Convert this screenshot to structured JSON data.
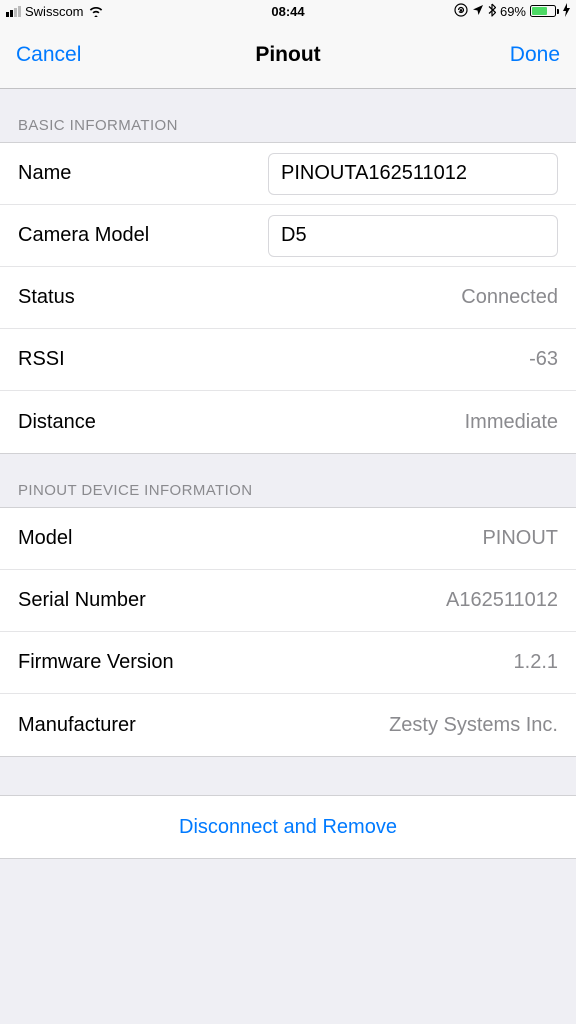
{
  "statusBar": {
    "carrier": "Swisscom",
    "time": "08:44",
    "battery": "69%",
    "batteryPct": 69
  },
  "nav": {
    "cancel": "Cancel",
    "title": "Pinout",
    "done": "Done"
  },
  "sections": {
    "basic": {
      "header": "BASIC INFORMATION",
      "nameLabel": "Name",
      "nameValue": "PINOUTA162511012",
      "cameraLabel": "Camera Model",
      "cameraValue": "D5",
      "statusLabel": "Status",
      "statusValue": "Connected",
      "rssiLabel": "RSSI",
      "rssiValue": "-63",
      "distanceLabel": "Distance",
      "distanceValue": "Immediate"
    },
    "device": {
      "header": "PINOUT DEVICE INFORMATION",
      "modelLabel": "Model",
      "modelValue": "PINOUT",
      "serialLabel": "Serial Number",
      "serialValue": "A162511012",
      "firmwareLabel": "Firmware Version",
      "firmwareValue": "1.2.1",
      "manufacturerLabel": "Manufacturer",
      "manufacturerValue": "Zesty Systems Inc."
    }
  },
  "action": {
    "disconnect": "Disconnect and Remove"
  }
}
